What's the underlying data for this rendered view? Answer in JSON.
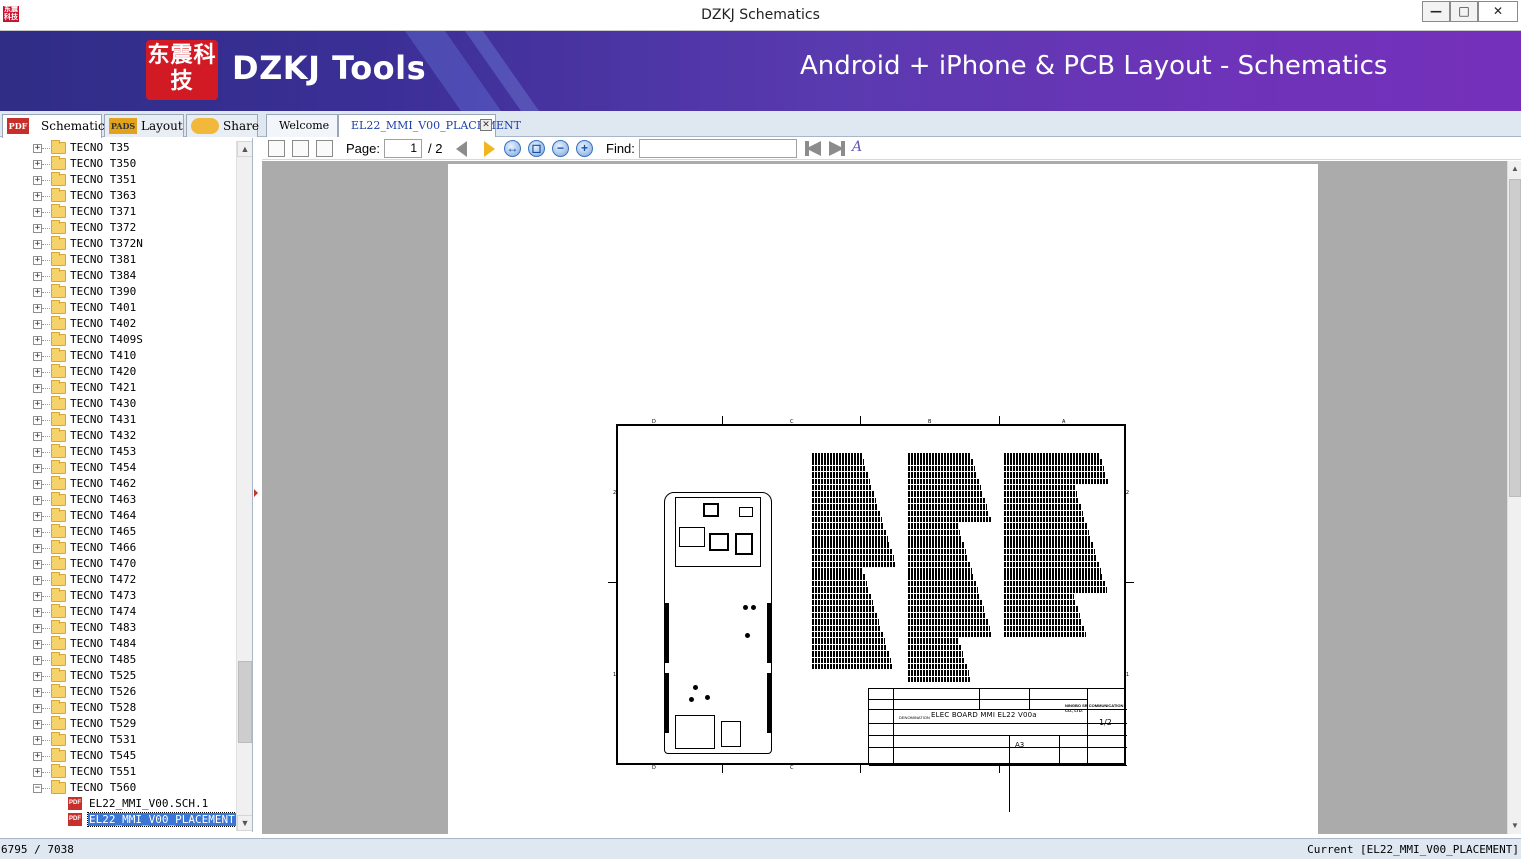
{
  "window": {
    "title": "DZKJ Schematics",
    "app_icon_text": "东震科技",
    "minimize": "—",
    "maximize": "□",
    "close": "✕"
  },
  "banner": {
    "logo_text": "东震科技",
    "brand": "DZKJ Tools",
    "tagline": "Android + iPhone & PCB Layout - Schematics",
    "background_color": "#3b2f96"
  },
  "side_tabs": [
    {
      "label": "Schematic",
      "icon": "PDF",
      "active": true
    },
    {
      "label": "Layout",
      "icon": "PADS",
      "active": false
    },
    {
      "label": "Share",
      "icon": "share-cloud",
      "active": false
    }
  ],
  "doc_tabs": [
    {
      "label": "Welcome",
      "active": false
    },
    {
      "label": "EL22_MMI_V00_PLACEMENT",
      "active": true,
      "close": "✕"
    }
  ],
  "tree": {
    "folders": [
      "TECNO T35",
      "TECNO T350",
      "TECNO T351",
      "TECNO T363",
      "TECNO T371",
      "TECNO T372",
      "TECNO T372N",
      "TECNO T381",
      "TECNO T384",
      "TECNO T390",
      "TECNO T401",
      "TECNO T402",
      "TECNO T409S",
      "TECNO T410",
      "TECNO T420",
      "TECNO T421",
      "TECNO T430",
      "TECNO T431",
      "TECNO T432",
      "TECNO T453",
      "TECNO T454",
      "TECNO T462",
      "TECNO T463",
      "TECNO T464",
      "TECNO T465",
      "TECNO T466",
      "TECNO T470",
      "TECNO T472",
      "TECNO T473",
      "TECNO T474",
      "TECNO T483",
      "TECNO T484",
      "TECNO T485",
      "TECNO T525",
      "TECNO T526",
      "TECNO T528",
      "TECNO T529",
      "TECNO T531",
      "TECNO T545",
      "TECNO T551"
    ],
    "expanded_folder": "TECNO T560",
    "files": [
      {
        "label": "EL22_MMI_V00.SCH.1",
        "selected": false
      },
      {
        "label": "EL22_MMI_V00_PLACEMENT",
        "selected": true
      }
    ],
    "expander_collapsed": "+",
    "expander_expanded": "−"
  },
  "toolbar": {
    "page_label": "Page:",
    "page_value": "1",
    "page_total": "/ 2",
    "find_label": "Find:",
    "find_value": "",
    "zoom_out": "−",
    "zoom_in": "+"
  },
  "schematic": {
    "zone_letters_top": [
      "D",
      "C",
      "B",
      "A"
    ],
    "zone_numbers": [
      "2",
      "1"
    ],
    "denomination_label": "DENOMINATION",
    "denomination": "ELEC BOARD MMI EL22 V00a",
    "sheet": "1/2",
    "size": "A3",
    "company": "NINGBO SR COMMUNICATION CO., LTD."
  },
  "status": {
    "count": "6795 / 7038",
    "current": "Current [EL22_MMI_V00_PLACEMENT]"
  }
}
